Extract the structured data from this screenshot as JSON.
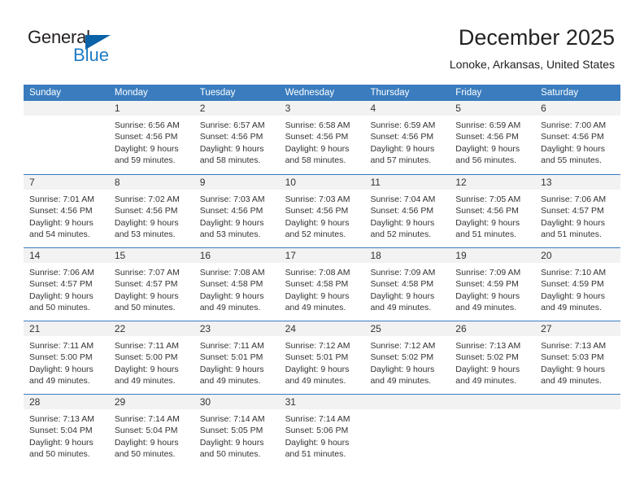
{
  "brand": {
    "word_one": "General",
    "word_two": "Blue",
    "triangle_icon": "blue-triangle-icon"
  },
  "header": {
    "title": "December 2025",
    "subtitle": "Lonoke, Arkansas, United States"
  },
  "colors": {
    "header_blue": "#3a7cbe",
    "brand_blue": "#1f7bc1",
    "triangle_blue": "#0a62a8",
    "day_head_gray": "#f2f2f2",
    "text": "#333333"
  },
  "weekdays": [
    "Sunday",
    "Monday",
    "Tuesday",
    "Wednesday",
    "Thursday",
    "Friday",
    "Saturday"
  ],
  "weeks": [
    [
      {
        "day": "",
        "lines": [
          "",
          "",
          "",
          ""
        ]
      },
      {
        "day": "1",
        "lines": [
          "Sunrise: 6:56 AM",
          "Sunset: 4:56 PM",
          "Daylight: 9 hours",
          "and 59 minutes."
        ]
      },
      {
        "day": "2",
        "lines": [
          "Sunrise: 6:57 AM",
          "Sunset: 4:56 PM",
          "Daylight: 9 hours",
          "and 58 minutes."
        ]
      },
      {
        "day": "3",
        "lines": [
          "Sunrise: 6:58 AM",
          "Sunset: 4:56 PM",
          "Daylight: 9 hours",
          "and 58 minutes."
        ]
      },
      {
        "day": "4",
        "lines": [
          "Sunrise: 6:59 AM",
          "Sunset: 4:56 PM",
          "Daylight: 9 hours",
          "and 57 minutes."
        ]
      },
      {
        "day": "5",
        "lines": [
          "Sunrise: 6:59 AM",
          "Sunset: 4:56 PM",
          "Daylight: 9 hours",
          "and 56 minutes."
        ]
      },
      {
        "day": "6",
        "lines": [
          "Sunrise: 7:00 AM",
          "Sunset: 4:56 PM",
          "Daylight: 9 hours",
          "and 55 minutes."
        ]
      }
    ],
    [
      {
        "day": "7",
        "lines": [
          "Sunrise: 7:01 AM",
          "Sunset: 4:56 PM",
          "Daylight: 9 hours",
          "and 54 minutes."
        ]
      },
      {
        "day": "8",
        "lines": [
          "Sunrise: 7:02 AM",
          "Sunset: 4:56 PM",
          "Daylight: 9 hours",
          "and 53 minutes."
        ]
      },
      {
        "day": "9",
        "lines": [
          "Sunrise: 7:03 AM",
          "Sunset: 4:56 PM",
          "Daylight: 9 hours",
          "and 53 minutes."
        ]
      },
      {
        "day": "10",
        "lines": [
          "Sunrise: 7:03 AM",
          "Sunset: 4:56 PM",
          "Daylight: 9 hours",
          "and 52 minutes."
        ]
      },
      {
        "day": "11",
        "lines": [
          "Sunrise: 7:04 AM",
          "Sunset: 4:56 PM",
          "Daylight: 9 hours",
          "and 52 minutes."
        ]
      },
      {
        "day": "12",
        "lines": [
          "Sunrise: 7:05 AM",
          "Sunset: 4:56 PM",
          "Daylight: 9 hours",
          "and 51 minutes."
        ]
      },
      {
        "day": "13",
        "lines": [
          "Sunrise: 7:06 AM",
          "Sunset: 4:57 PM",
          "Daylight: 9 hours",
          "and 51 minutes."
        ]
      }
    ],
    [
      {
        "day": "14",
        "lines": [
          "Sunrise: 7:06 AM",
          "Sunset: 4:57 PM",
          "Daylight: 9 hours",
          "and 50 minutes."
        ]
      },
      {
        "day": "15",
        "lines": [
          "Sunrise: 7:07 AM",
          "Sunset: 4:57 PM",
          "Daylight: 9 hours",
          "and 50 minutes."
        ]
      },
      {
        "day": "16",
        "lines": [
          "Sunrise: 7:08 AM",
          "Sunset: 4:58 PM",
          "Daylight: 9 hours",
          "and 49 minutes."
        ]
      },
      {
        "day": "17",
        "lines": [
          "Sunrise: 7:08 AM",
          "Sunset: 4:58 PM",
          "Daylight: 9 hours",
          "and 49 minutes."
        ]
      },
      {
        "day": "18",
        "lines": [
          "Sunrise: 7:09 AM",
          "Sunset: 4:58 PM",
          "Daylight: 9 hours",
          "and 49 minutes."
        ]
      },
      {
        "day": "19",
        "lines": [
          "Sunrise: 7:09 AM",
          "Sunset: 4:59 PM",
          "Daylight: 9 hours",
          "and 49 minutes."
        ]
      },
      {
        "day": "20",
        "lines": [
          "Sunrise: 7:10 AM",
          "Sunset: 4:59 PM",
          "Daylight: 9 hours",
          "and 49 minutes."
        ]
      }
    ],
    [
      {
        "day": "21",
        "lines": [
          "Sunrise: 7:11 AM",
          "Sunset: 5:00 PM",
          "Daylight: 9 hours",
          "and 49 minutes."
        ]
      },
      {
        "day": "22",
        "lines": [
          "Sunrise: 7:11 AM",
          "Sunset: 5:00 PM",
          "Daylight: 9 hours",
          "and 49 minutes."
        ]
      },
      {
        "day": "23",
        "lines": [
          "Sunrise: 7:11 AM",
          "Sunset: 5:01 PM",
          "Daylight: 9 hours",
          "and 49 minutes."
        ]
      },
      {
        "day": "24",
        "lines": [
          "Sunrise: 7:12 AM",
          "Sunset: 5:01 PM",
          "Daylight: 9 hours",
          "and 49 minutes."
        ]
      },
      {
        "day": "25",
        "lines": [
          "Sunrise: 7:12 AM",
          "Sunset: 5:02 PM",
          "Daylight: 9 hours",
          "and 49 minutes."
        ]
      },
      {
        "day": "26",
        "lines": [
          "Sunrise: 7:13 AM",
          "Sunset: 5:02 PM",
          "Daylight: 9 hours",
          "and 49 minutes."
        ]
      },
      {
        "day": "27",
        "lines": [
          "Sunrise: 7:13 AM",
          "Sunset: 5:03 PM",
          "Daylight: 9 hours",
          "and 49 minutes."
        ]
      }
    ],
    [
      {
        "day": "28",
        "lines": [
          "Sunrise: 7:13 AM",
          "Sunset: 5:04 PM",
          "Daylight: 9 hours",
          "and 50 minutes."
        ]
      },
      {
        "day": "29",
        "lines": [
          "Sunrise: 7:14 AM",
          "Sunset: 5:04 PM",
          "Daylight: 9 hours",
          "and 50 minutes."
        ]
      },
      {
        "day": "30",
        "lines": [
          "Sunrise: 7:14 AM",
          "Sunset: 5:05 PM",
          "Daylight: 9 hours",
          "and 50 minutes."
        ]
      },
      {
        "day": "31",
        "lines": [
          "Sunrise: 7:14 AM",
          "Sunset: 5:06 PM",
          "Daylight: 9 hours",
          "and 51 minutes."
        ]
      },
      {
        "day": "",
        "lines": [
          "",
          "",
          "",
          ""
        ]
      },
      {
        "day": "",
        "lines": [
          "",
          "",
          "",
          ""
        ]
      },
      {
        "day": "",
        "lines": [
          "",
          "",
          "",
          ""
        ]
      }
    ]
  ]
}
